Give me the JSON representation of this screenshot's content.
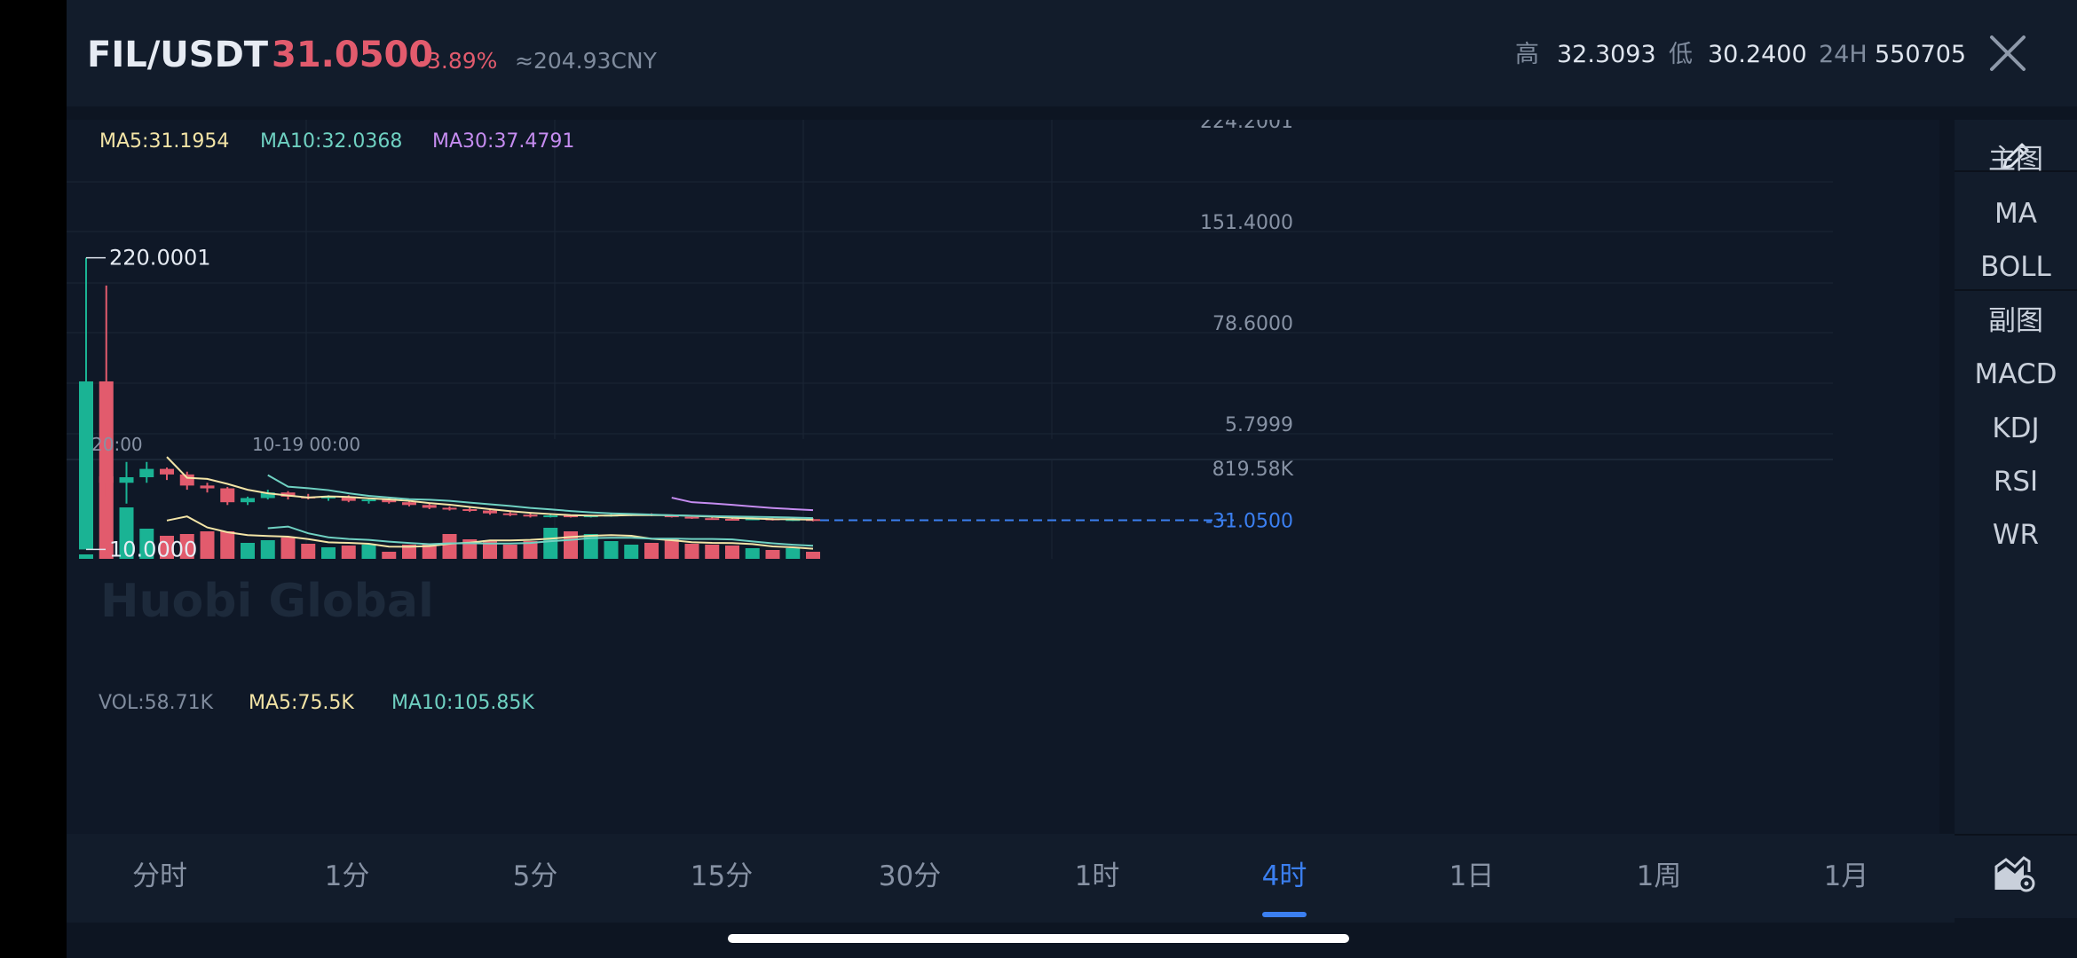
{
  "header": {
    "pair": "FIL/USDT",
    "last_price": "31.0500",
    "change_pct": "-3.89%",
    "cny_value": "≈204.93CNY",
    "high_label": "高",
    "high_value": "32.3093",
    "low_label": "低",
    "low_value": "30.2400",
    "vol24_label": "24H",
    "vol24_value": "550705"
  },
  "indicators": {
    "ma5": "MA5:31.1954",
    "ma10": "MA10:32.0368",
    "ma30": "MA30:37.4791",
    "vol": "VOL:58.71K",
    "vol_ma5": "MA5:75.5K",
    "vol_ma10": "MA10:105.85K"
  },
  "watermark": "Huobi Global",
  "sidebar": {
    "items": [
      {
        "label": "主图",
        "active": false
      },
      {
        "label": "MA",
        "active": true
      },
      {
        "label": "BOLL",
        "active": false
      },
      {
        "label": "副图",
        "active": false
      },
      {
        "label": "MACD",
        "active": true
      },
      {
        "label": "KDJ",
        "active": false
      },
      {
        "label": "RSI",
        "active": false
      },
      {
        "label": "WR",
        "active": false
      }
    ],
    "edit_icon": "pencil-icon",
    "settings_icon": "chart-settings-icon"
  },
  "timeframes": [
    {
      "label": "分时",
      "active": false
    },
    {
      "label": "1分",
      "active": false
    },
    {
      "label": "5分",
      "active": false
    },
    {
      "label": "15分",
      "active": false
    },
    {
      "label": "30分",
      "active": false
    },
    {
      "label": "1时",
      "active": false
    },
    {
      "label": "4时",
      "active": true
    },
    {
      "label": "1日",
      "active": false
    },
    {
      "label": "1周",
      "active": false
    },
    {
      "label": "1月",
      "active": false
    }
  ],
  "colors": {
    "up": "#1ab394",
    "down": "#e25b6d",
    "ma5": "#f3e4a6",
    "ma10": "#6fd1c2",
    "ma30": "#c58cf0",
    "accent": "#3b7ff0"
  },
  "chart_data": {
    "type": "candlestick",
    "interval": "4时",
    "price_axis": {
      "ticks": [
        "224.2001",
        "151.4000",
        "78.6000",
        "5.7999"
      ],
      "range": [
        5.7999,
        224.2001
      ]
    },
    "time_axis": {
      "ticks": [
        "20:00",
        "10-19 00:00"
      ]
    },
    "current_price_line": "31.0500",
    "max_label": "220.0001",
    "min_label": "10.0000",
    "candles": [
      {
        "o": 10.0,
        "h": 220.0,
        "l": 10.0,
        "c": 131.0
      },
      {
        "o": 131.0,
        "h": 200.0,
        "l": 48.0,
        "c": 58.0
      },
      {
        "o": 58.0,
        "h": 73.0,
        "l": 43.0,
        "c": 62.0
      },
      {
        "o": 62.0,
        "h": 73.0,
        "l": 58.0,
        "c": 68.0
      },
      {
        "o": 68.0,
        "h": 69.0,
        "l": 60.0,
        "c": 64.0
      },
      {
        "o": 64.0,
        "h": 66.0,
        "l": 53.0,
        "c": 56.0
      },
      {
        "o": 56.0,
        "h": 58.0,
        "l": 51.0,
        "c": 54.0
      },
      {
        "o": 54.0,
        "h": 55.0,
        "l": 42.0,
        "c": 44.0
      },
      {
        "o": 44.0,
        "h": 48.0,
        "l": 42.0,
        "c": 47.0
      },
      {
        "o": 47.0,
        "h": 53.0,
        "l": 46.0,
        "c": 51.0
      },
      {
        "o": 51.0,
        "h": 52.0,
        "l": 46.0,
        "c": 48.0
      },
      {
        "o": 48.0,
        "h": 50.0,
        "l": 46.0,
        "c": 47.0
      },
      {
        "o": 47.0,
        "h": 49.0,
        "l": 45.0,
        "c": 48.0
      },
      {
        "o": 48.0,
        "h": 49.0,
        "l": 44.0,
        "c": 45.0
      },
      {
        "o": 45.0,
        "h": 47.0,
        "l": 43.0,
        "c": 46.0
      },
      {
        "o": 46.0,
        "h": 47.0,
        "l": 43.0,
        "c": 44.0
      },
      {
        "o": 44.0,
        "h": 45.0,
        "l": 41.0,
        "c": 42.0
      },
      {
        "o": 42.0,
        "h": 43.0,
        "l": 39.0,
        "c": 40.0
      },
      {
        "o": 40.0,
        "h": 41.0,
        "l": 38.0,
        "c": 39.0
      },
      {
        "o": 39.0,
        "h": 40.0,
        "l": 37.0,
        "c": 38.0
      },
      {
        "o": 38.0,
        "h": 39.0,
        "l": 35.0,
        "c": 36.0
      },
      {
        "o": 36.0,
        "h": 37.0,
        "l": 34.0,
        "c": 35.0
      },
      {
        "o": 35.0,
        "h": 36.0,
        "l": 33.0,
        "c": 34.0
      },
      {
        "o": 34.0,
        "h": 35.0,
        "l": 33.0,
        "c": 34.5
      },
      {
        "o": 34.5,
        "h": 35.0,
        "l": 33.0,
        "c": 34.0
      },
      {
        "o": 34.0,
        "h": 35.0,
        "l": 33.0,
        "c": 34.5
      },
      {
        "o": 34.5,
        "h": 36.0,
        "l": 33.5,
        "c": 35.0
      },
      {
        "o": 35.0,
        "h": 36.0,
        "l": 34.0,
        "c": 35.5
      },
      {
        "o": 35.5,
        "h": 36.0,
        "l": 34.0,
        "c": 34.5
      },
      {
        "o": 34.5,
        "h": 35.0,
        "l": 33.0,
        "c": 33.5
      },
      {
        "o": 33.5,
        "h": 34.0,
        "l": 32.0,
        "c": 32.5
      },
      {
        "o": 32.5,
        "h": 33.0,
        "l": 31.5,
        "c": 32.0
      },
      {
        "o": 32.0,
        "h": 32.8,
        "l": 31.0,
        "c": 31.4
      },
      {
        "o": 31.4,
        "h": 33.0,
        "l": 31.0,
        "c": 32.3
      },
      {
        "o": 32.3,
        "h": 32.5,
        "l": 30.8,
        "c": 31.0
      },
      {
        "o": 31.0,
        "h": 32.0,
        "l": 30.5,
        "c": 31.8
      },
      {
        "o": 31.8,
        "h": 32.3,
        "l": 30.24,
        "c": 31.05
      }
    ],
    "volumes": [
      5,
      93,
      58,
      34,
      26,
      28,
      31,
      31,
      18,
      21,
      24,
      17,
      13,
      15,
      16,
      8,
      16,
      17,
      28,
      22,
      21,
      16,
      20,
      35,
      31,
      28,
      20,
      16,
      18,
      23,
      17,
      16,
      15,
      12,
      10,
      12,
      8
    ],
    "volume_axis": {
      "max": "819.58K"
    }
  }
}
